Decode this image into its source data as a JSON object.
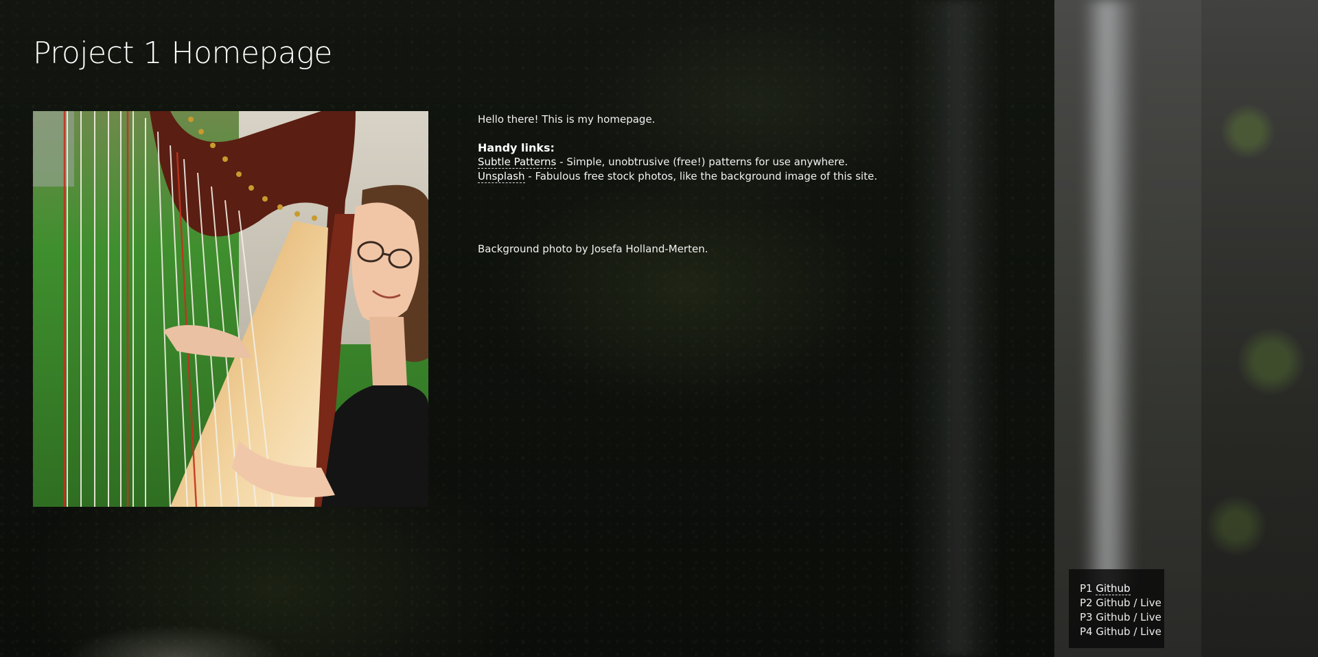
{
  "page": {
    "title": "Project 1 Homepage"
  },
  "photo": {
    "icon": "harp-player-photo"
  },
  "intro": {
    "greeting": "Hello there! This is my homepage.",
    "handy_links_title": "Handy links:",
    "links": [
      {
        "label": "Subtle Patterns",
        "description": " - Simple, unobtrusive (free!) patterns for use anywhere."
      },
      {
        "label": "Unsplash",
        "description": " - Fabulous free stock photos, like the background image of this site."
      }
    ],
    "credit": "Background photo by Josefa Holland-Merten."
  },
  "projects": [
    {
      "prefix": "P1 ",
      "github": "Github",
      "separator": "",
      "live": ""
    },
    {
      "prefix": "P2 ",
      "github": "Github",
      "separator": " / ",
      "live": "Live"
    },
    {
      "prefix": "P3 ",
      "github": "Github",
      "separator": " / ",
      "live": "Live"
    },
    {
      "prefix": "P4 ",
      "github": "Github",
      "separator": " / ",
      "live": "Live"
    }
  ],
  "colors": {
    "background": "#0c0d0b",
    "text": "#f2f2f2",
    "panel": "#0a0a0a"
  }
}
